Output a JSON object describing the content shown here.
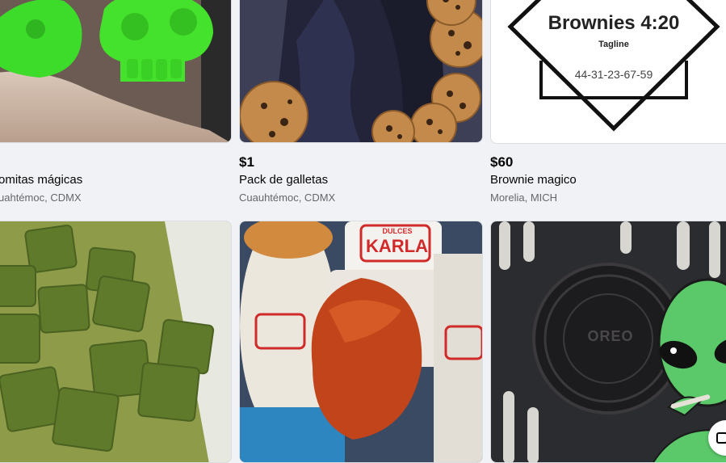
{
  "listings": [
    {
      "price": "",
      "title": "omitas mágicas",
      "location": "uahtémoc, CDMX"
    },
    {
      "price": "$1",
      "title": "Pack de galletas",
      "location": "Cuauhtémoc, CDMX"
    },
    {
      "price": "$60",
      "title": "Brownie magico",
      "location": "Morelia, MICH"
    },
    {
      "price": "",
      "title": "",
      "location": ""
    },
    {
      "price": "",
      "title": "",
      "location": ""
    },
    {
      "price": "",
      "title": "",
      "location": ""
    }
  ],
  "logo": {
    "title": "Brownies 4:20",
    "tagline": "Tagline",
    "phone": "44-31-23-67-59"
  },
  "jars": {
    "brand_top": "DULCES",
    "brand": "KARLA"
  },
  "cookie_brand": "OREO",
  "fab": {
    "icon": "compose-icon"
  }
}
